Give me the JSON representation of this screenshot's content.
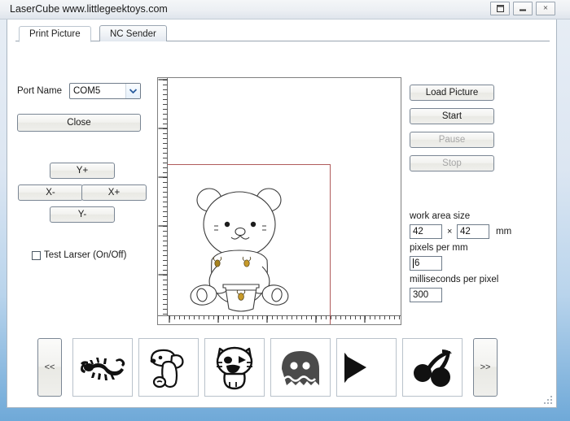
{
  "window": {
    "title": "LaserCube  www.littlegeektoys.com",
    "controls": [
      {
        "name": "restore",
        "glyph": "restore-icon"
      },
      {
        "name": "minimize",
        "glyph": "minimize-icon"
      },
      {
        "name": "close",
        "glyph": "close-icon",
        "label": "X"
      }
    ]
  },
  "tabs": [
    {
      "id": "print-picture",
      "label": "Print Picture",
      "selected": true
    },
    {
      "id": "nc-sender",
      "label": "NC Sender",
      "selected": false
    }
  ],
  "left_panel": {
    "port_label": "Port Name",
    "port_value": "COM5",
    "port_options": [
      "COM5"
    ],
    "close_button": "Close",
    "jog": {
      "y_plus": "Y+",
      "x_minus": "X-",
      "x_plus": "X+",
      "y_minus": "Y-"
    },
    "test_laser_label": "Test Larser (On/Off)",
    "test_laser_checked": false
  },
  "right_panel": {
    "load_picture": "Load Picture",
    "start": "Start",
    "pause": "Pause",
    "stop": "Stop",
    "pause_enabled": false,
    "stop_enabled": false,
    "work_area_label": "work area size",
    "work_area_width": "42",
    "work_area_height": "42",
    "work_area_times": "×",
    "work_area_unit": "mm",
    "pixels_per_mm_label": "pixels per mm",
    "pixels_per_mm_value": "6",
    "ms_per_pixel_label": "milliseconds per pixel",
    "ms_per_pixel_value": "300"
  },
  "preview": {
    "image_name": "teddy-bear-with-honey-pot",
    "work_rect_color": "#b05b5b"
  },
  "gallery": {
    "prev_label": "<<",
    "next_label": ">>",
    "items": [
      {
        "name": "scorpion",
        "label": "scorpion"
      },
      {
        "name": "snoopy-dog",
        "label": "snoopy"
      },
      {
        "name": "angry-cat",
        "label": "cat"
      },
      {
        "name": "pacman-ghost",
        "label": "ghost"
      },
      {
        "name": "pac-man",
        "label": "pacman"
      },
      {
        "name": "cherries",
        "label": "cherries"
      }
    ]
  },
  "colors": {
    "window_border": "#6fa9d8",
    "accent": "#b05b5b",
    "button_face": "#efefec"
  }
}
